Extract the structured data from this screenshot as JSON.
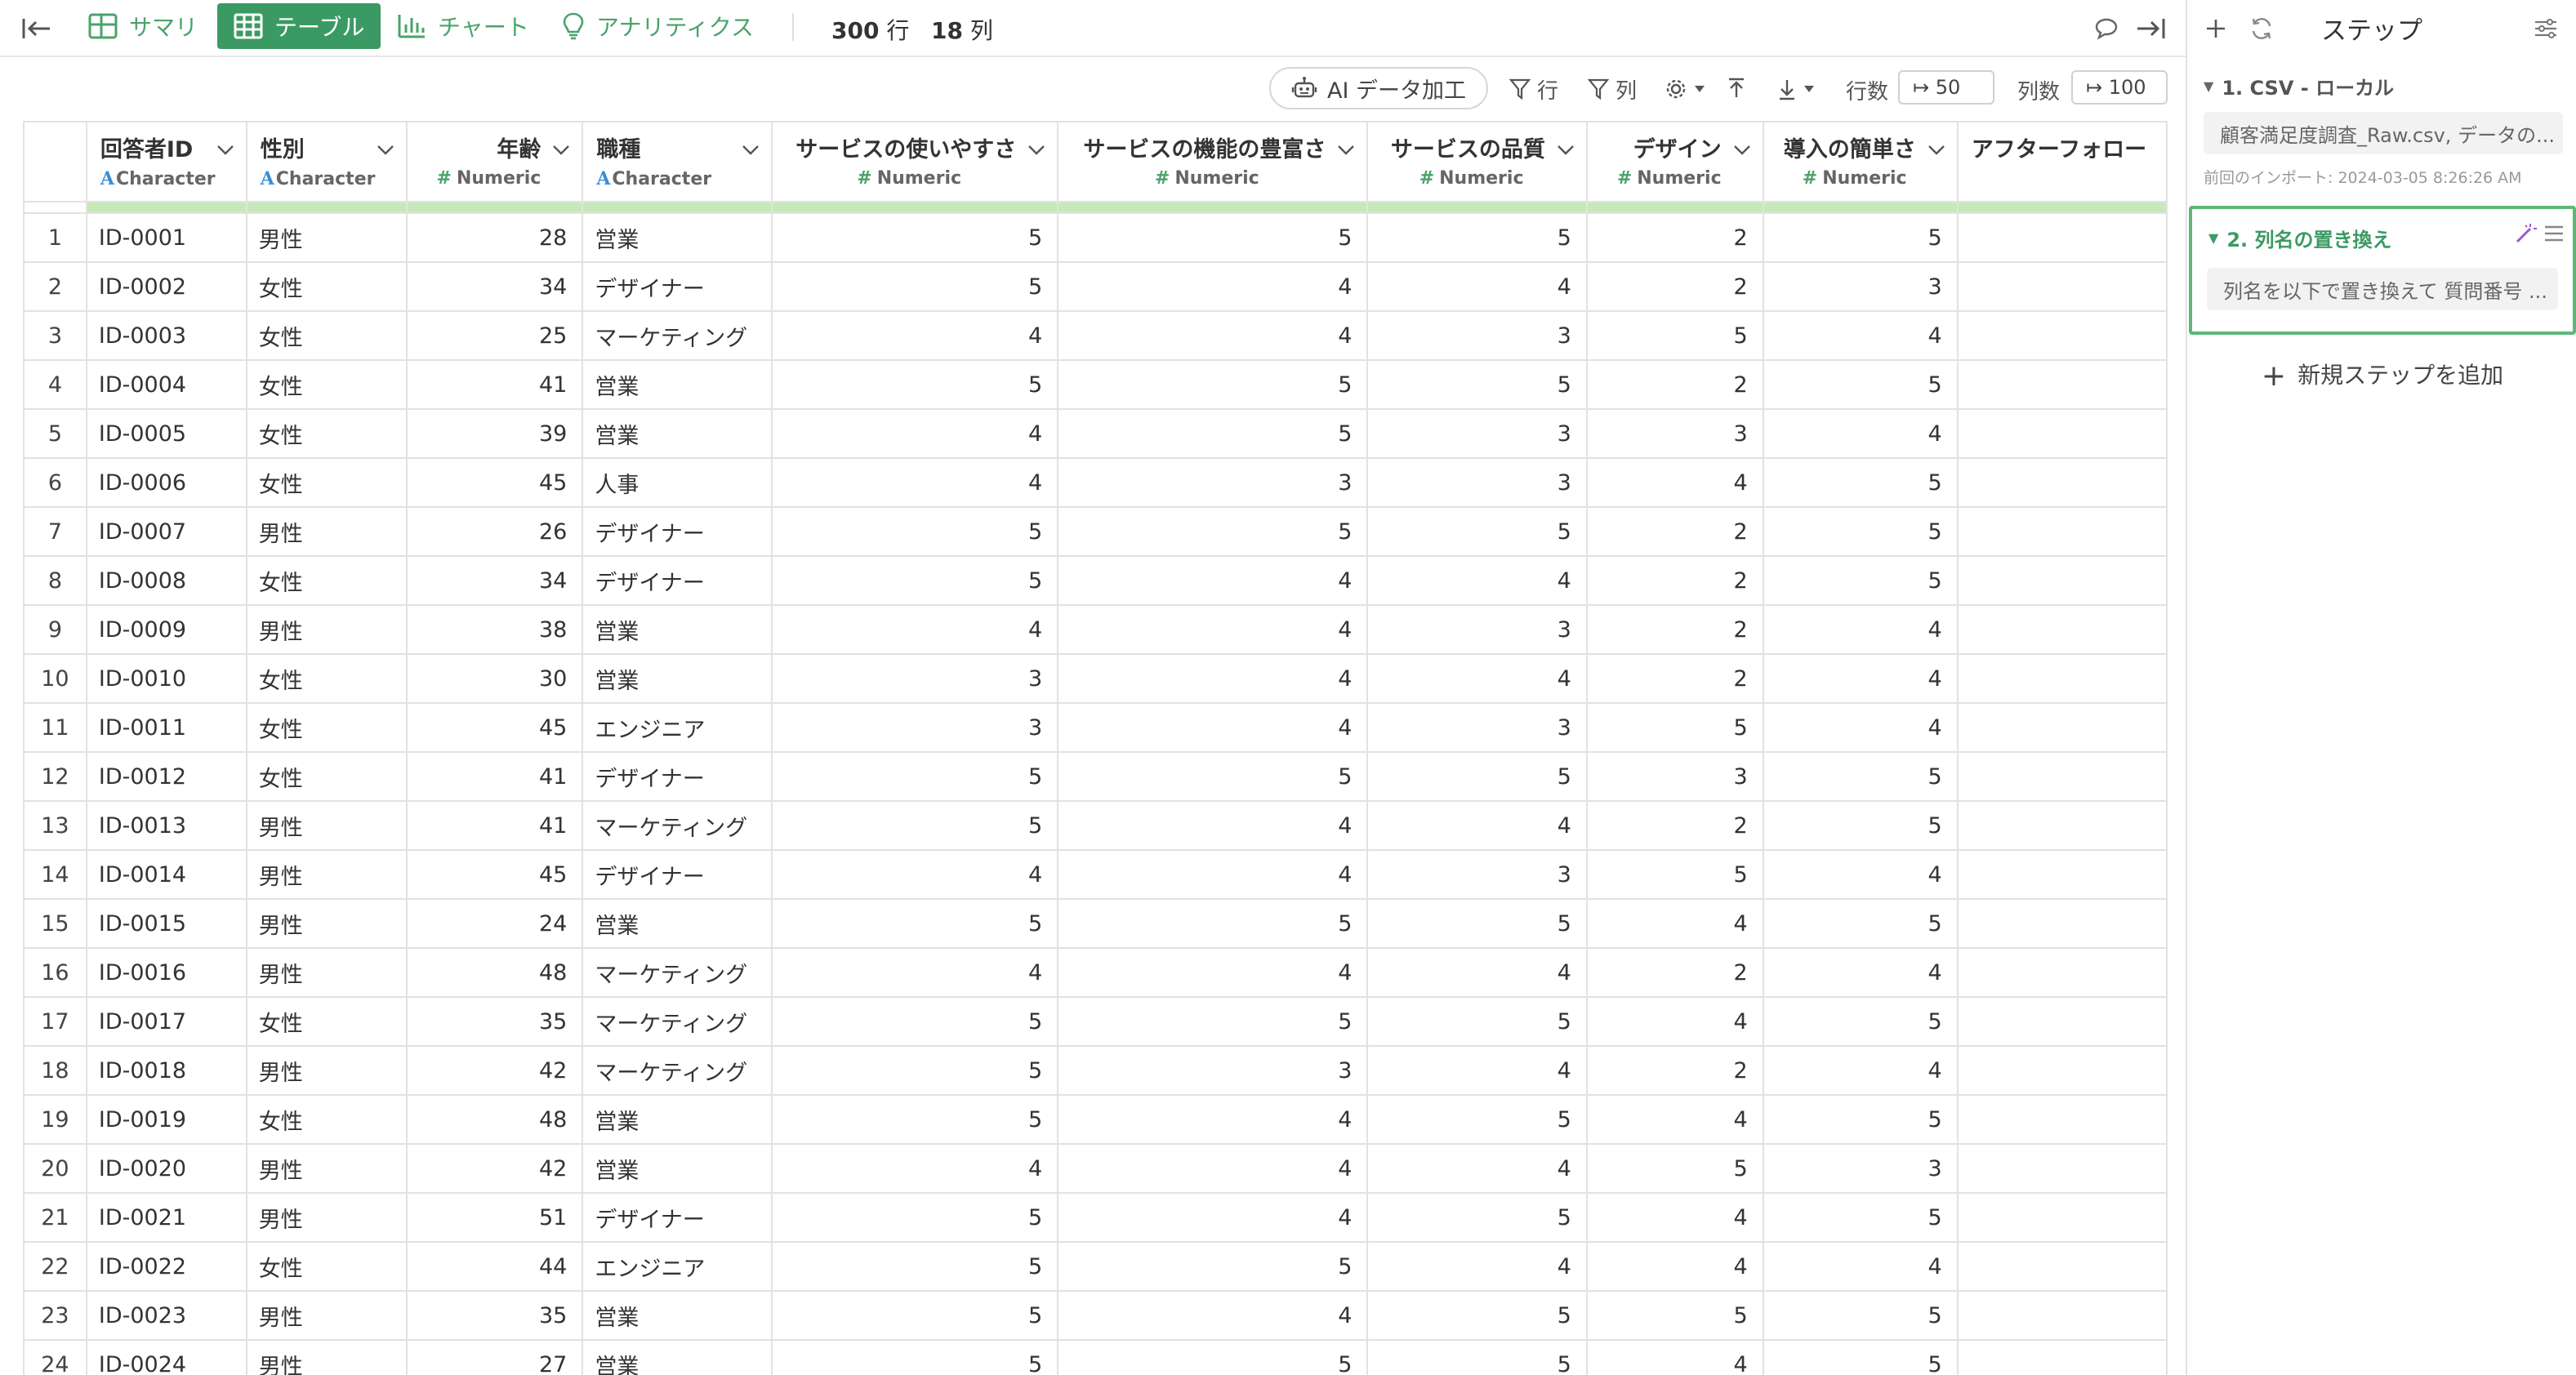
{
  "toolbar": {
    "tabs": [
      {
        "label": "サマリ",
        "icon": "summary-table-icon"
      },
      {
        "label": "テーブル",
        "icon": "table-icon"
      },
      {
        "label": "チャート",
        "icon": "bar-chart-icon"
      },
      {
        "label": "アナリティクス",
        "icon": "lightbulb-icon"
      }
    ],
    "rows_count": "300",
    "rows_unit": "行",
    "cols_count": "18",
    "cols_unit": "列"
  },
  "subbar": {
    "ai_label": "AI データ加工",
    "filter_rows": "行",
    "filter_cols": "列",
    "rows_label": "行数",
    "rows_value": "↦ 50",
    "cols_label": "列数",
    "cols_value": "↦ 100"
  },
  "table": {
    "columns": [
      {
        "name": "回答者ID",
        "type": "Character"
      },
      {
        "name": "性別",
        "type": "Character"
      },
      {
        "name": "年齢",
        "type": "Numeric"
      },
      {
        "name": "職種",
        "type": "Character"
      },
      {
        "name": "サービスの使いやすさ",
        "type": "Numeric"
      },
      {
        "name": "サービスの機能の豊富さ",
        "type": "Numeric"
      },
      {
        "name": "サービスの品質",
        "type": "Numeric"
      },
      {
        "name": "デザイン",
        "type": "Numeric"
      },
      {
        "name": "導入の簡単さ",
        "type": "Numeric"
      },
      {
        "name": "アフターフォロー",
        "type": ""
      }
    ],
    "rows": [
      [
        "1",
        "ID-0001",
        "男性",
        "28",
        "営業",
        "5",
        "5",
        "5",
        "2",
        "5"
      ],
      [
        "2",
        "ID-0002",
        "女性",
        "34",
        "デザイナー",
        "5",
        "4",
        "4",
        "2",
        "3"
      ],
      [
        "3",
        "ID-0003",
        "女性",
        "25",
        "マーケティング",
        "4",
        "4",
        "3",
        "5",
        "4"
      ],
      [
        "4",
        "ID-0004",
        "女性",
        "41",
        "営業",
        "5",
        "5",
        "5",
        "2",
        "5"
      ],
      [
        "5",
        "ID-0005",
        "女性",
        "39",
        "営業",
        "4",
        "5",
        "3",
        "3",
        "4"
      ],
      [
        "6",
        "ID-0006",
        "女性",
        "45",
        "人事",
        "4",
        "3",
        "3",
        "4",
        "5"
      ],
      [
        "7",
        "ID-0007",
        "男性",
        "26",
        "デザイナー",
        "5",
        "5",
        "5",
        "2",
        "5"
      ],
      [
        "8",
        "ID-0008",
        "女性",
        "34",
        "デザイナー",
        "5",
        "4",
        "4",
        "2",
        "5"
      ],
      [
        "9",
        "ID-0009",
        "男性",
        "38",
        "営業",
        "4",
        "4",
        "3",
        "2",
        "4"
      ],
      [
        "10",
        "ID-0010",
        "女性",
        "30",
        "営業",
        "3",
        "4",
        "4",
        "2",
        "4"
      ],
      [
        "11",
        "ID-0011",
        "女性",
        "45",
        "エンジニア",
        "3",
        "4",
        "3",
        "5",
        "4"
      ],
      [
        "12",
        "ID-0012",
        "女性",
        "41",
        "デザイナー",
        "5",
        "5",
        "5",
        "3",
        "5"
      ],
      [
        "13",
        "ID-0013",
        "男性",
        "41",
        "マーケティング",
        "5",
        "4",
        "4",
        "2",
        "5"
      ],
      [
        "14",
        "ID-0014",
        "男性",
        "45",
        "デザイナー",
        "4",
        "4",
        "3",
        "5",
        "4"
      ],
      [
        "15",
        "ID-0015",
        "男性",
        "24",
        "営業",
        "5",
        "5",
        "5",
        "4",
        "5"
      ],
      [
        "16",
        "ID-0016",
        "男性",
        "48",
        "マーケティング",
        "4",
        "4",
        "4",
        "2",
        "4"
      ],
      [
        "17",
        "ID-0017",
        "女性",
        "35",
        "マーケティング",
        "5",
        "5",
        "5",
        "4",
        "5"
      ],
      [
        "18",
        "ID-0018",
        "男性",
        "42",
        "マーケティング",
        "5",
        "3",
        "4",
        "2",
        "4"
      ],
      [
        "19",
        "ID-0019",
        "女性",
        "48",
        "営業",
        "5",
        "4",
        "5",
        "4",
        "5"
      ],
      [
        "20",
        "ID-0020",
        "男性",
        "42",
        "営業",
        "4",
        "4",
        "4",
        "5",
        "3"
      ],
      [
        "21",
        "ID-0021",
        "男性",
        "51",
        "デザイナー",
        "5",
        "4",
        "5",
        "4",
        "5"
      ],
      [
        "22",
        "ID-0022",
        "女性",
        "44",
        "エンジニア",
        "5",
        "5",
        "4",
        "4",
        "4"
      ],
      [
        "23",
        "ID-0023",
        "男性",
        "35",
        "営業",
        "5",
        "4",
        "5",
        "5",
        "5"
      ],
      [
        "24",
        "ID-0024",
        "男性",
        "27",
        "営業",
        "5",
        "5",
        "5",
        "4",
        "5"
      ]
    ]
  },
  "steps_panel": {
    "title": "ステップ",
    "steps": [
      {
        "title": "1. CSV - ローカル",
        "desc": "顧客満足度調査_Raw.csv, データの...",
        "meta": "前回のインポート: 2024-03-05 8:26:26 AM"
      },
      {
        "title": "2. 列名の置き換え",
        "desc": "列名を以下で置き換えて 質問番号 ..."
      }
    ],
    "add_step": "新規ステップを追加"
  },
  "colors": {
    "accent": "#3b9a63",
    "accent_text": "#4aa36a",
    "strip": "#c5eab8",
    "char_type": "#3a8fd6"
  }
}
